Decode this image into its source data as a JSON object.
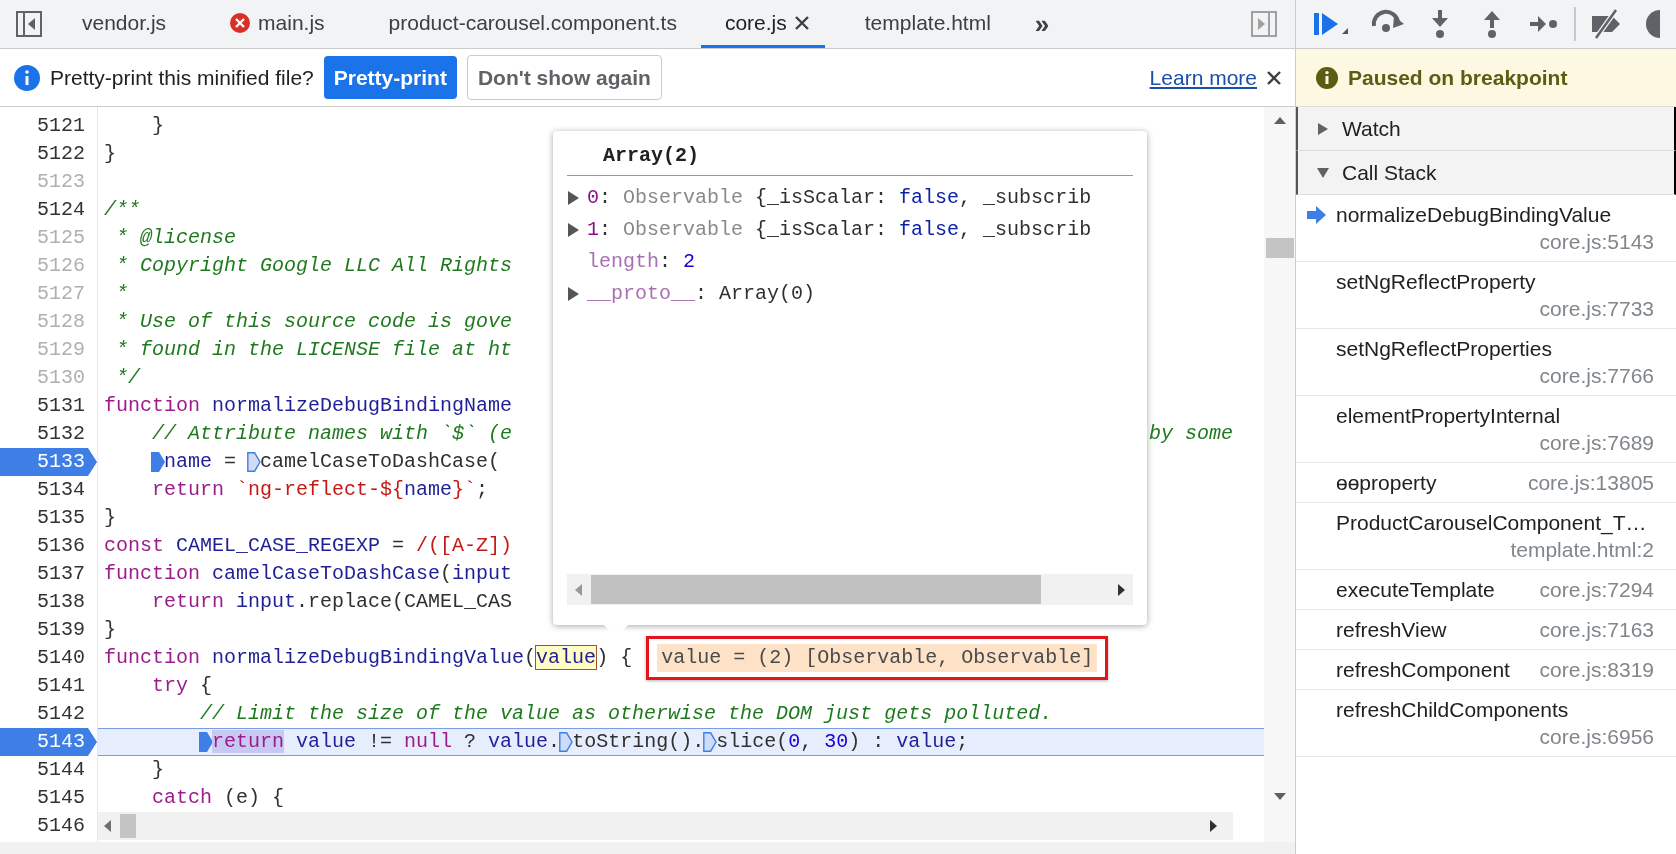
{
  "editor_tabs": {
    "items": [
      {
        "label": "vendor.js",
        "selected": false,
        "error": false
      },
      {
        "label": "main.js",
        "selected": false,
        "error": true
      },
      {
        "label": "product-carousel.component.ts",
        "selected": false,
        "error": false
      },
      {
        "label": "core.js",
        "selected": true,
        "error": false
      },
      {
        "label": "template.html",
        "selected": false,
        "error": false
      }
    ],
    "more": "»"
  },
  "infobar": {
    "message": "Pretty-print this minified file?",
    "primary_button": "Pretty-print",
    "secondary_button": "Don't show again",
    "link": "Learn more"
  },
  "code": {
    "lines": [
      {
        "number": "5121",
        "breakable": true,
        "tokens": [
          {
            "text": "    }",
            "kind": "plain"
          }
        ]
      },
      {
        "number": "5122",
        "breakable": true,
        "tokens": [
          {
            "text": "}",
            "kind": "plain"
          }
        ]
      },
      {
        "number": "5123",
        "breakable": false
      },
      {
        "number": "5124",
        "breakable": true,
        "tokens": [
          {
            "text": "/**",
            "kind": "comment"
          }
        ]
      },
      {
        "number": "5125",
        "breakable": false,
        "tokens": [
          {
            "text": " * @license",
            "kind": "comment"
          }
        ]
      },
      {
        "number": "5126",
        "breakable": false,
        "tokens": [
          {
            "text": " * Copyright Google LLC All Rights",
            "kind": "comment"
          }
        ]
      },
      {
        "number": "5127",
        "breakable": false,
        "tokens": [
          {
            "text": " *",
            "kind": "comment"
          }
        ]
      },
      {
        "number": "5128",
        "breakable": false,
        "tokens": [
          {
            "text": " * Use of this source code is gove",
            "kind": "comment"
          }
        ]
      },
      {
        "number": "5129",
        "breakable": false,
        "tokens": [
          {
            "text": " * found in the LICENSE file at ht",
            "kind": "comment"
          }
        ]
      },
      {
        "number": "5130",
        "breakable": false,
        "tokens": [
          {
            "text": " */",
            "kind": "comment"
          }
        ]
      },
      {
        "number": "5131",
        "breakable": true,
        "tokens": [
          {
            "text": "function ",
            "kind": "keyword"
          },
          {
            "text": "normalizeDebugBindingName",
            "kind": "identifier"
          }
        ]
      },
      {
        "number": "5132",
        "breakable": true,
        "tokens": [
          {
            "text": "    // Attribute names with `$` (e",
            "kind": "comment"
          }
        ],
        "right": [
          {
            "text": "by some",
            "kind": "comment"
          }
        ]
      },
      {
        "number": "5133",
        "breakable": true,
        "breakpoint": true,
        "tokens": [
          {
            "text": "    name",
            "kind": "identifier",
            "marker": true,
            "marker_active": true
          },
          {
            "text": " = ",
            "kind": "plain"
          },
          {
            "text": "camelCaseToDashCase(",
            "kind": "plain",
            "marker": true,
            "marker_active": false
          }
        ]
      },
      {
        "number": "5134",
        "breakable": true,
        "tokens": [
          {
            "text": "    return ",
            "kind": "keyword"
          },
          {
            "text": "`ng-reflect-${",
            "kind": "string"
          },
          {
            "text": "name",
            "kind": "identifier"
          },
          {
            "text": "}`",
            "kind": "string"
          },
          {
            "text": ";",
            "kind": "plain"
          }
        ]
      },
      {
        "number": "5135",
        "breakable": true,
        "tokens": [
          {
            "text": "}",
            "kind": "plain"
          }
        ]
      },
      {
        "number": "5136",
        "breakable": true,
        "tokens": [
          {
            "text": "const ",
            "kind": "keyword"
          },
          {
            "text": "CAMEL_CASE_REGEXP",
            "kind": "identifier"
          },
          {
            "text": " = ",
            "kind": "plain"
          },
          {
            "text": "/([A-Z])",
            "kind": "string"
          }
        ]
      },
      {
        "number": "5137",
        "breakable": true,
        "tokens": [
          {
            "text": "function ",
            "kind": "keyword"
          },
          {
            "text": "camelCaseToDashCase",
            "kind": "identifier"
          },
          {
            "text": "(",
            "kind": "plain"
          },
          {
            "text": "input",
            "kind": "identifier"
          }
        ]
      },
      {
        "number": "5138",
        "breakable": true,
        "tokens": [
          {
            "text": "    return ",
            "kind": "keyword"
          },
          {
            "text": "input",
            "kind": "identifier"
          },
          {
            "text": ".replace(CAMEL_CAS",
            "kind": "plain"
          }
        ]
      },
      {
        "number": "5139",
        "breakable": true,
        "tokens": [
          {
            "text": "}",
            "kind": "plain"
          }
        ]
      },
      {
        "number": "5140",
        "breakable": true,
        "tokens": [
          {
            "text": "function ",
            "kind": "keyword"
          },
          {
            "text": "normalizeDebugBindingValue",
            "kind": "identifier"
          },
          {
            "text": "(",
            "kind": "plain"
          },
          {
            "text": "value",
            "kind": "identifier",
            "hover": true
          },
          {
            "text": ") {",
            "kind": "plain"
          }
        ],
        "inline_value": "value = (2) [Observable, Observable]"
      },
      {
        "number": "5141",
        "breakable": true,
        "tokens": [
          {
            "text": "    try ",
            "kind": "keyword"
          },
          {
            "text": "{",
            "kind": "plain"
          }
        ]
      },
      {
        "number": "5142",
        "breakable": true,
        "tokens": [
          {
            "text": "        // Limit the size of the value as otherwise the DOM just gets polluted.",
            "kind": "comment"
          }
        ]
      },
      {
        "number": "5143",
        "breakable": true,
        "breakpoint": true,
        "current": true,
        "tokens": [
          {
            "text": "        return",
            "kind": "keyword",
            "highlight": true,
            "marker": true,
            "marker_active": true
          },
          {
            "text": " value",
            "kind": "identifier"
          },
          {
            "text": " != ",
            "kind": "plain"
          },
          {
            "text": "null",
            "kind": "keyword"
          },
          {
            "text": " ? ",
            "kind": "plain"
          },
          {
            "text": "value",
            "kind": "identifier"
          },
          {
            "text": ".",
            "kind": "plain"
          },
          {
            "text": "toString().",
            "kind": "plain",
            "marker": true,
            "marker_active": false
          },
          {
            "text": "slice(",
            "kind": "plain",
            "marker": true,
            "marker_active": false
          },
          {
            "text": "0",
            "kind": "number"
          },
          {
            "text": ", ",
            "kind": "plain"
          },
          {
            "text": "30",
            "kind": "number"
          },
          {
            "text": ") : ",
            "kind": "plain"
          },
          {
            "text": "value",
            "kind": "identifier"
          },
          {
            "text": ";",
            "kind": "plain"
          }
        ]
      },
      {
        "number": "5144",
        "breakable": true,
        "tokens": [
          {
            "text": "    }",
            "kind": "plain"
          }
        ]
      },
      {
        "number": "5145",
        "breakable": true,
        "tokens": [
          {
            "text": "    catch ",
            "kind": "keyword"
          },
          {
            "text": "(e) {",
            "kind": "plain"
          }
        ]
      },
      {
        "number": "5146",
        "breakable": true
      }
    ]
  },
  "popup": {
    "title": "Array(2)",
    "entries": [
      {
        "expandable": true,
        "tokens": [
          {
            "text": "0",
            "kind": "key"
          },
          {
            "text": ": ",
            "kind": "plain"
          },
          {
            "text": "Observable",
            "kind": "type"
          },
          {
            "text": " {_isScalar: ",
            "kind": "plain"
          },
          {
            "text": "false",
            "kind": "boolean"
          },
          {
            "text": ", _subscrib",
            "kind": "plain"
          }
        ]
      },
      {
        "expandable": true,
        "tokens": [
          {
            "text": "1",
            "kind": "key"
          },
          {
            "text": ": ",
            "kind": "plain"
          },
          {
            "text": "Observable",
            "kind": "type"
          },
          {
            "text": " {_isScalar: ",
            "kind": "plain"
          },
          {
            "text": "false",
            "kind": "boolean"
          },
          {
            "text": ", _subscrib",
            "kind": "plain"
          }
        ]
      },
      {
        "expandable": false,
        "tokens": [
          {
            "text": "length",
            "kind": "internal"
          },
          {
            "text": ": ",
            "kind": "plain"
          },
          {
            "text": "2",
            "kind": "number"
          }
        ]
      },
      {
        "expandable": true,
        "tokens": [
          {
            "text": "__proto__",
            "kind": "internal"
          },
          {
            "text": ": ",
            "kind": "plain"
          },
          {
            "text": "Array(0)",
            "kind": "plain"
          }
        ]
      }
    ]
  },
  "debugger": {
    "banner": "Paused on breakpoint",
    "sections": [
      {
        "label": "Watch",
        "expanded": false
      },
      {
        "label": "Call Stack",
        "expanded": true
      }
    ],
    "call_stack": [
      {
        "name": "normalizeDebugBindingValue",
        "location": "core.js:5143",
        "selected": true
      },
      {
        "name": "setNgReflectProperty",
        "location": "core.js:7733",
        "selected": false
      },
      {
        "name": "setNgReflectProperties",
        "location": "core.js:7766",
        "selected": false
      },
      {
        "name": "elementPropertyInternal",
        "location": "core.js:7689",
        "selected": false
      },
      {
        "name": "ɵɵproperty",
        "location": "core.js:13805",
        "selected": false
      },
      {
        "name": "ProductCarouselComponent_T…",
        "location": "template.html:2",
        "selected": false
      },
      {
        "name": "executeTemplate",
        "location": "core.js:7294",
        "selected": false
      },
      {
        "name": "refreshView",
        "location": "core.js:7163",
        "selected": false
      },
      {
        "name": "refreshComponent",
        "location": "core.js:8319",
        "selected": false
      },
      {
        "name": "refreshChildComponents",
        "location": "core.js:6956",
        "selected": false
      }
    ]
  }
}
